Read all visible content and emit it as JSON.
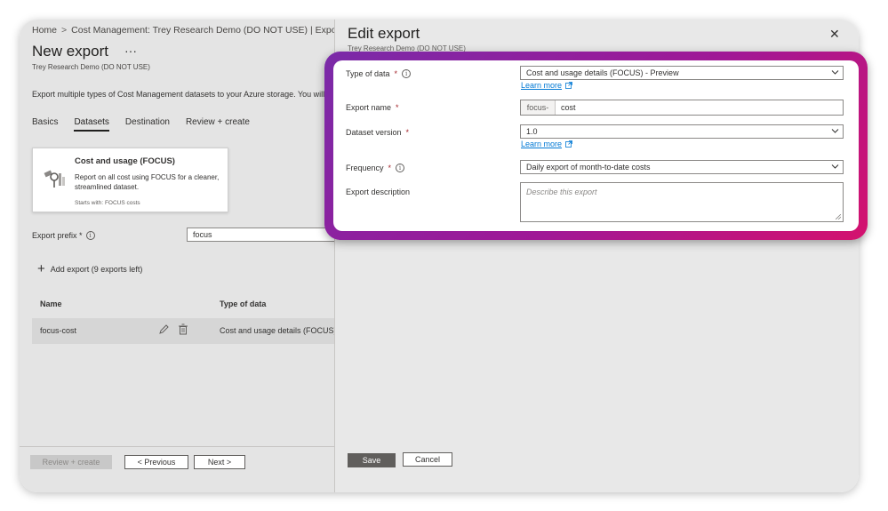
{
  "breadcrumb": {
    "home": "Home",
    "cost_mgmt": "Cost Management: Trey Research Demo (DO NOT USE) | Exports",
    "sep": ">"
  },
  "page": {
    "title": "New export",
    "more": "···",
    "subtitle": "Trey Research Demo (DO NOT USE)",
    "description": "Export multiple types of Cost Management datasets to your Azure storage. You will"
  },
  "tabs": [
    {
      "label": "Basics"
    },
    {
      "label": "Datasets"
    },
    {
      "label": "Destination"
    },
    {
      "label": "Review + create"
    }
  ],
  "card": {
    "title": "Cost and usage (FOCUS)",
    "description": "Report on all cost using FOCUS for a cleaner, streamlined dataset.",
    "footer": "Starts with: FOCUS costs"
  },
  "prefix": {
    "label": "Export prefix *",
    "value": "focus"
  },
  "add_export": {
    "label": "Add export (9 exports left)"
  },
  "table": {
    "headers": [
      "Name",
      "Type of data"
    ],
    "rows": [
      {
        "name": "focus-cost",
        "type": "Cost and usage details (FOCUS) -"
      }
    ]
  },
  "footer": {
    "review": "Review + create",
    "previous": "< Previous",
    "next": "Next >"
  },
  "edit": {
    "title": "Edit export",
    "subtitle": "Trey Research Demo (DO NOT USE)",
    "close": "✕",
    "save": "Save",
    "cancel": "Cancel"
  },
  "form": {
    "type_label": "Type of data",
    "type_value": "Cost and usage details (FOCUS) - Preview",
    "learn_more": "Learn more",
    "name_label": "Export name",
    "name_prefix": "focus-",
    "name_value": "cost",
    "version_label": "Dataset version",
    "version_value": "1.0",
    "frequency_label": "Frequency",
    "frequency_value": "Daily export of month-to-date costs",
    "description_label": "Export description",
    "description_placeholder": "Describe this export",
    "required_mark": "*"
  },
  "colors": {
    "highlight_start": "#7a2aa8",
    "highlight_end": "#d4126e",
    "link": "#0078d4"
  }
}
